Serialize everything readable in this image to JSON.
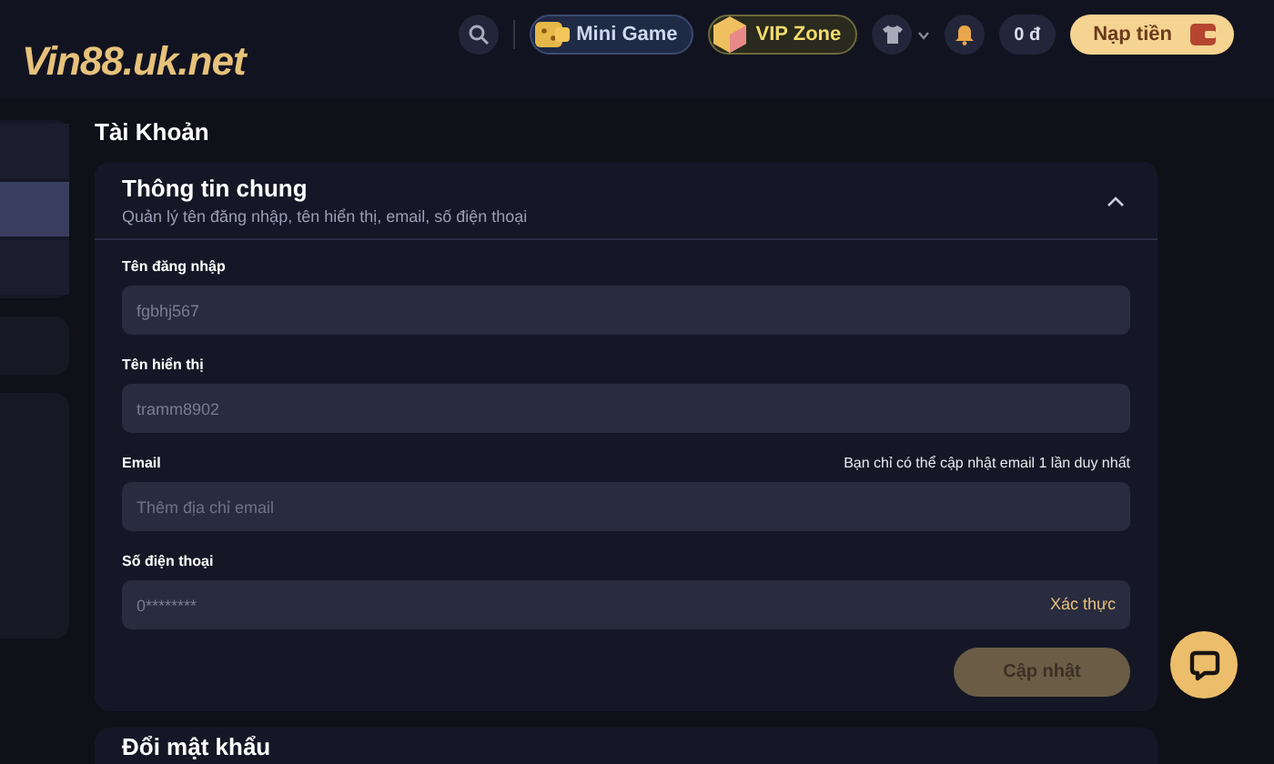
{
  "header": {
    "logo": "Vin88.uk.net",
    "mini_game": "Mini Game",
    "vip_zone": "VIP Zone",
    "balance": "0 đ",
    "deposit": "Nạp tiền"
  },
  "sidebar": {
    "items": [
      {
        "selected": false
      },
      {
        "selected": true
      },
      {
        "selected": false
      }
    ]
  },
  "page_title": "Tài Khoản",
  "card": {
    "title": "Thông tin chung",
    "subtitle": "Quản lý tên đăng nhập, tên hiển thị, email, số điện thoại",
    "expanded": true,
    "fields": [
      {
        "label": "Tên đăng nhập",
        "value": "fgbhj567"
      },
      {
        "label": "Tên hiển thị",
        "value": "tramm8902"
      },
      {
        "label": "Email",
        "note": "Bạn chỉ có thể cập nhật email 1 lần duy nhất",
        "placeholder": "Thêm địa chỉ email"
      },
      {
        "label": "Số điện thoại",
        "value": "0********",
        "action": "Xác thực"
      }
    ],
    "submit": {
      "label": "Cập nhật",
      "disabled": true
    }
  },
  "next_card": {
    "title": "Đổi mật khẩu"
  }
}
